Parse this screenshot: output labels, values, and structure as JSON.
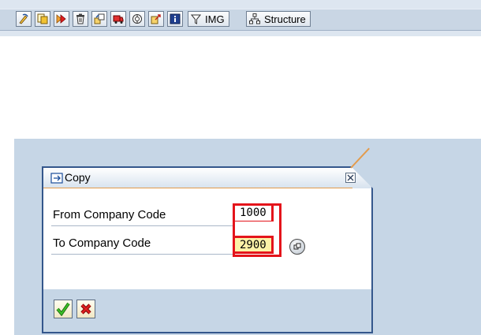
{
  "toolbar": {
    "buttons": [
      {
        "icon": "change-display-icon"
      },
      {
        "icon": "copy-as-icon"
      },
      {
        "icon": "execute-icon"
      },
      {
        "icon": "delete-icon"
      },
      {
        "icon": "rename-icon"
      },
      {
        "icon": "transport-icon"
      },
      {
        "icon": "settings-icon"
      },
      {
        "icon": "export-icon"
      },
      {
        "icon": "info-icon"
      }
    ],
    "img_label": "IMG",
    "structure_label": "Structure"
  },
  "dialog": {
    "title": "Copy",
    "from_label": "From Company Code",
    "from_value": "1000",
    "to_label": "To Company Code",
    "to_value": "2900"
  },
  "colors": {
    "highlight_border": "#e4141b",
    "input_highlight_bg": "#fcf2a8",
    "accent_line": "#e39b4c",
    "confirm_green": "#2e9a1c",
    "cancel_red": "#d01818"
  }
}
